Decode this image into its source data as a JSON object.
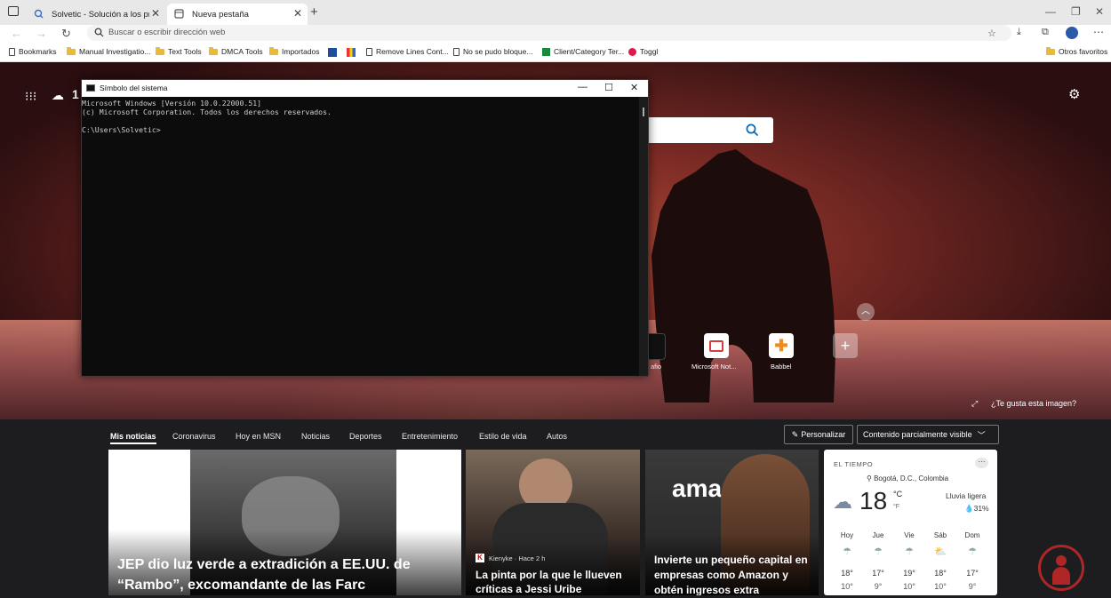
{
  "browser": {
    "tabs": [
      {
        "title": "Solvetic - Solución a los problem"
      },
      {
        "title": "Nueva pestaña"
      }
    ],
    "address_placeholder": "Buscar o escribir dirección web",
    "bookmarks": [
      {
        "label": "Bookmarks",
        "icon": "page-icon"
      },
      {
        "label": "Manual Investigatio...",
        "icon": "folder-icon"
      },
      {
        "label": "Text Tools",
        "icon": "folder-icon"
      },
      {
        "label": "DMCA Tools",
        "icon": "folder-icon"
      },
      {
        "label": "Importados",
        "icon": "folder-icon"
      },
      {
        "label": "Remove Lines Cont...",
        "icon": "favicon"
      },
      {
        "label": "No se pudo bloque...",
        "icon": "page-icon"
      },
      {
        "label": "Client/Category Ter...",
        "icon": "favicon"
      },
      {
        "label": "Toggl",
        "icon": "favicon"
      }
    ],
    "other_favorites": "Otros favoritos"
  },
  "cmd": {
    "title": "Símbolo del sistema",
    "lines": [
      "Microsoft Windows [Versión 10.0.22000.51]",
      "(c) Microsoft Corporation. Todos los derechos reservados.",
      "",
      "C:\\Users\\Solvetic>"
    ]
  },
  "newtab": {
    "weather_temp_partial": "1",
    "quick_links": [
      {
        "label": "afio"
      },
      {
        "label": "Microsoft Not..."
      },
      {
        "label": "Babbel"
      }
    ],
    "like_image": "¿Te gusta esta imagen?"
  },
  "news": {
    "categories": [
      "Mis noticias",
      "Coronavirus",
      "Hoy en MSN",
      "Noticias",
      "Deportes",
      "Entretenimiento",
      "Estilo de vida",
      "Autos"
    ],
    "personalize": "Personalizar",
    "content_filter": "Contenido parcialmente visible",
    "cards": [
      {
        "title": "JEP dio luz verde a extradición a EE.UU. de “Rambo”, excomandante de las Farc"
      },
      {
        "source": "Kienyke · Hace 2 h",
        "title": "La pinta por la que le llueven críticas a Jessi Uribe"
      },
      {
        "title": "Invierte un pequeño capital en empresas como Amazon y obtén ingresos extra",
        "brand": "amaz"
      }
    ]
  },
  "weather": {
    "header": "EL TIEMPO",
    "location": "Bogotá, D.C., Colombia",
    "temp": "18",
    "unit_c": "°C",
    "unit_f": "°F",
    "condition": "Lluvia ligera",
    "precip": "31%",
    "days": [
      {
        "name": "Hoy",
        "high": "18°",
        "low": "10°"
      },
      {
        "name": "Jue",
        "high": "17°",
        "low": "9°"
      },
      {
        "name": "Vie",
        "high": "19°",
        "low": "10°"
      },
      {
        "name": "Sáb",
        "high": "18°",
        "low": "10°"
      },
      {
        "name": "Dom",
        "high": "17°",
        "low": "9°"
      }
    ]
  },
  "colors": {
    "accent": "#0067b8",
    "cmd_bg": "#0c0c0c"
  }
}
